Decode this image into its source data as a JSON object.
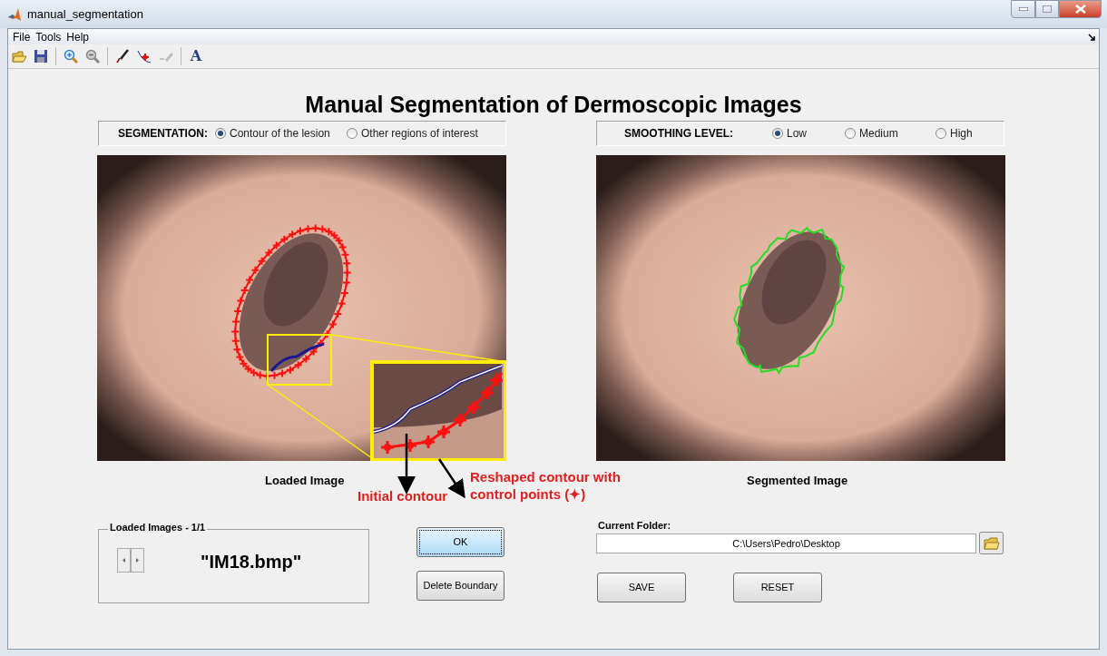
{
  "window": {
    "title": "manual_segmentation"
  },
  "menu": [
    {
      "label": "File"
    },
    {
      "label": "Tools"
    },
    {
      "label": "Help"
    }
  ],
  "toolbar": [
    {
      "kind": "open",
      "disabled": false
    },
    {
      "kind": "save",
      "disabled": false
    },
    {
      "kind": "zoom_in",
      "disabled": false
    },
    {
      "kind": "zoom_out",
      "disabled": false
    },
    {
      "kind": "brush",
      "disabled": false
    },
    {
      "kind": "points",
      "disabled": false
    },
    {
      "kind": "pen",
      "disabled": true
    },
    {
      "kind": "text",
      "glyph": "A",
      "disabled": false
    }
  ],
  "heading": "Manual Segmentation of Dermoscopic Images",
  "segmentation": {
    "label": "SEGMENTATION:",
    "options": [
      {
        "label": "Contour of the lesion",
        "selected": true
      },
      {
        "label": "Other regions of interest",
        "selected": false
      }
    ]
  },
  "smoothing": {
    "label": "SMOOTHING LEVEL:",
    "options": [
      {
        "label": "Low",
        "selected": true
      },
      {
        "label": "Medium",
        "selected": false
      },
      {
        "label": "High",
        "selected": false
      }
    ]
  },
  "loaded_image": {
    "caption": "Loaded Image",
    "annotations": [
      "Initial contour",
      "Reshaped contour with control points (✦)"
    ]
  },
  "segmented_image": {
    "caption": "Segmented Image"
  },
  "loaded_images": {
    "title": "Loaded Images - 1/1",
    "filename": "\"IM18.bmp\""
  },
  "actions": {
    "ok": "OK",
    "delete": "Delete Boundary",
    "save": "SAVE",
    "reset": "RESET"
  },
  "current_folder": {
    "label": "Current Folder:",
    "value": "C:\\Users\\Pedro\\Desktop"
  }
}
